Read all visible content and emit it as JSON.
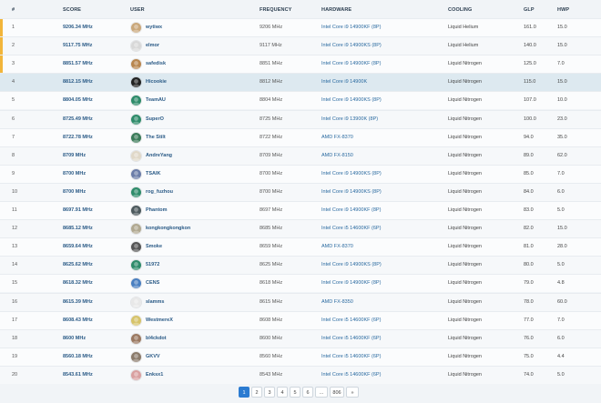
{
  "columns": {
    "rank": "#",
    "score": "SCORE",
    "user": "USER",
    "frequency": "FREQUENCY",
    "hardware": "HARDWARE",
    "cooling": "COOLING",
    "glp": "GLP",
    "hwp": "HWP"
  },
  "rows": [
    {
      "rank": "1",
      "score": "9206.34 MHz",
      "user": "wytiwx",
      "freq": "9206 MHz",
      "hw": "Intel Core i9 14900KF (8P)",
      "cool": "Liquid Helium",
      "glp": "161.0",
      "hwp": "15.0"
    },
    {
      "rank": "2",
      "score": "9117.75 MHz",
      "user": "elmor",
      "freq": "9117 MHz",
      "hw": "Intel Core i9 14900KS (8P)",
      "cool": "Liquid Helium",
      "glp": "140.0",
      "hwp": "15.0"
    },
    {
      "rank": "3",
      "score": "8851.57 MHz",
      "user": "safedisk",
      "freq": "8851 MHz",
      "hw": "Intel Core i9 14900KF (8P)",
      "cool": "Liquid Nitrogen",
      "glp": "125.0",
      "hwp": "7.0"
    },
    {
      "rank": "4",
      "score": "8812.15 MHz",
      "user": "Hicookie",
      "freq": "8812 MHz",
      "hw": "Intel Core i9 14900K",
      "cool": "Liquid Nitrogen",
      "glp": "115.0",
      "hwp": "15.0"
    },
    {
      "rank": "5",
      "score": "8804.05 MHz",
      "user": "TeamAU",
      "freq": "8804 MHz",
      "hw": "Intel Core i9 14900KS (8P)",
      "cool": "Liquid Nitrogen",
      "glp": "107.0",
      "hwp": "10.0"
    },
    {
      "rank": "6",
      "score": "8725.49 MHz",
      "user": "SuperO",
      "freq": "8725 MHz",
      "hw": "Intel Core i9 13900K (8P)",
      "cool": "Liquid Nitrogen",
      "glp": "100.0",
      "hwp": "23.0"
    },
    {
      "rank": "7",
      "score": "8722.78 MHz",
      "user": "The Stilt",
      "freq": "8722 MHz",
      "hw": "AMD FX-8370",
      "cool": "Liquid Nitrogen",
      "glp": "94.0",
      "hwp": "35.0"
    },
    {
      "rank": "8",
      "score": "8709 MHz",
      "user": "AndreYang",
      "freq": "8709 MHz",
      "hw": "AMD FX-8150",
      "cool": "Liquid Nitrogen",
      "glp": "89.0",
      "hwp": "62.0"
    },
    {
      "rank": "9",
      "score": "8700 MHz",
      "user": "TSAIK",
      "freq": "8700 MHz",
      "hw": "Intel Core i9 14900KS (8P)",
      "cool": "Liquid Nitrogen",
      "glp": "85.0",
      "hwp": "7.0"
    },
    {
      "rank": "10",
      "score": "8700 MHz",
      "user": "rog_fuzhou",
      "freq": "8700 MHz",
      "hw": "Intel Core i9 14900KS (8P)",
      "cool": "Liquid Nitrogen",
      "glp": "84.0",
      "hwp": "6.0"
    },
    {
      "rank": "11",
      "score": "8697.91 MHz",
      "user": "Phantom",
      "freq": "8697 MHz",
      "hw": "Intel Core i9 14900KF (8P)",
      "cool": "Liquid Nitrogen",
      "glp": "83.0",
      "hwp": "5.0"
    },
    {
      "rank": "12",
      "score": "8685.12 MHz",
      "user": "kongkongkongkon",
      "freq": "8685 MHz",
      "hw": "Intel Core i5 14600KF (6P)",
      "cool": "Liquid Nitrogen",
      "glp": "82.0",
      "hwp": "15.0"
    },
    {
      "rank": "13",
      "score": "8659.64 MHz",
      "user": "Smoke",
      "freq": "8659 MHz",
      "hw": "AMD FX-8370",
      "cool": "Liquid Nitrogen",
      "glp": "81.0",
      "hwp": "28.0"
    },
    {
      "rank": "14",
      "score": "8625.62 MHz",
      "user": "51972",
      "freq": "8625 MHz",
      "hw": "Intel Core i9 14900KS (8P)",
      "cool": "Liquid Nitrogen",
      "glp": "80.0",
      "hwp": "5.0"
    },
    {
      "rank": "15",
      "score": "8618.32 MHz",
      "user": "CENS",
      "freq": "8618 MHz",
      "hw": "Intel Core i9 14900KF (8P)",
      "cool": "Liquid Nitrogen",
      "glp": "79.0",
      "hwp": "4.8"
    },
    {
      "rank": "16",
      "score": "8615.39 MHz",
      "user": "slamms",
      "freq": "8615 MHz",
      "hw": "AMD FX-8350",
      "cool": "Liquid Nitrogen",
      "glp": "78.0",
      "hwp": "60.0"
    },
    {
      "rank": "17",
      "score": "8608.43 MHz",
      "user": "WestmereX",
      "freq": "8608 MHz",
      "hw": "Intel Core i5 14600KF (6P)",
      "cool": "Liquid Nitrogen",
      "glp": "77.0",
      "hwp": "7.0"
    },
    {
      "rank": "18",
      "score": "8600 MHz",
      "user": "bl4ckdot",
      "freq": "8600 MHz",
      "hw": "Intel Core i5 14600KF (6P)",
      "cool": "Liquid Nitrogen",
      "glp": "76.0",
      "hwp": "6.0"
    },
    {
      "rank": "19",
      "score": "8560.18 MHz",
      "user": "GKVV",
      "freq": "8560 MHz",
      "hw": "Intel Core i5 14600KF (6P)",
      "cool": "Liquid Nitrogen",
      "glp": "75.0",
      "hwp": "4.4"
    },
    {
      "rank": "20",
      "score": "8543.61 MHz",
      "user": "Enksx1",
      "freq": "8543 MHz",
      "hw": "Intel Core i5 14600KF (6P)",
      "cool": "Liquid Nitrogen",
      "glp": "74.0",
      "hwp": "5.0"
    }
  ],
  "avatar_colors": [
    "#c9a77a",
    "#d8d8d8",
    "#b8864f",
    "#222222",
    "#2e8b6a",
    "#2e8b6a",
    "#3a7a58",
    "#e0d8c8",
    "#6b7da8",
    "#2e8b6a",
    "#4d5a5e",
    "#b0a890",
    "#555555",
    "#2e8b6a",
    "#4a7fc0",
    "#e8e8e8",
    "#d6c36a",
    "#9a7860",
    "#8a7a6a",
    "#d9a0a0"
  ],
  "medal_colors": [
    "#f2b53a",
    "#f2b53a",
    "#f2b53a"
  ],
  "highlight_color": "#dde9f0",
  "pagination": {
    "pages": [
      "1",
      "2",
      "3",
      "4",
      "5",
      "6",
      "...",
      "806",
      "»"
    ],
    "active": "1"
  }
}
